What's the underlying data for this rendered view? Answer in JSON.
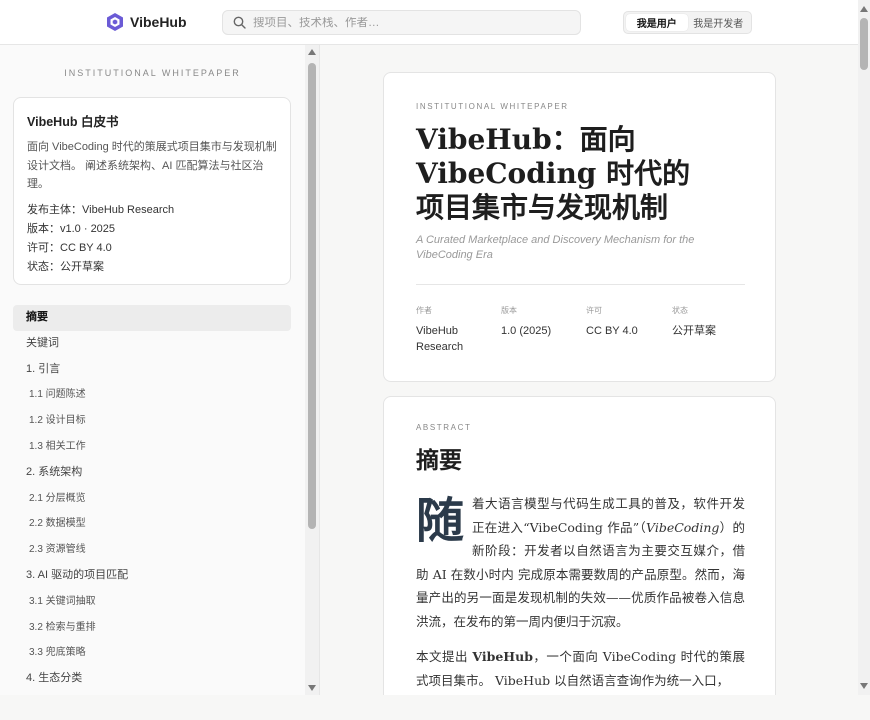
{
  "header": {
    "brand": "VibeHub",
    "search_placeholder": "搜项目、技术栈、作者…",
    "roles": [
      "我是用户",
      "我是开发者"
    ]
  },
  "sidebar": {
    "kicker": "INSTITUTIONAL WHITEPAPER",
    "card": {
      "title": "VibeHub 白皮书",
      "description": "面向 VibeCoding 时代的策展式项目集市与发现机制设计文档。 阐述系统架构、AI 匹配算法与社区治理。",
      "rows": [
        "发布主体：VibeHub Research",
        "版本：v1.0 · 2025",
        "许可：CC BY 4.0",
        "状态：公开草案"
      ]
    },
    "toc": [
      {
        "label": "摘要",
        "sub": false,
        "active": true
      },
      {
        "label": "关键词",
        "sub": false,
        "active": false
      },
      {
        "label": "1. 引言",
        "sub": false,
        "active": false
      },
      {
        "label": "1.1 问题陈述",
        "sub": true,
        "active": false
      },
      {
        "label": "1.2 设计目标",
        "sub": true,
        "active": false
      },
      {
        "label": "1.3 相关工作",
        "sub": true,
        "active": false
      },
      {
        "label": "2. 系统架构",
        "sub": false,
        "active": false
      },
      {
        "label": "2.1 分层概览",
        "sub": true,
        "active": false
      },
      {
        "label": "2.2 数据模型",
        "sub": true,
        "active": false
      },
      {
        "label": "2.3 资源管线",
        "sub": true,
        "active": false
      },
      {
        "label": "3. AI 驱动的项目匹配",
        "sub": false,
        "active": false
      },
      {
        "label": "3.1 关键词抽取",
        "sub": true,
        "active": false
      },
      {
        "label": "3.2 检索与重排",
        "sub": true,
        "active": false
      },
      {
        "label": "3.3 兜底策略",
        "sub": true,
        "active": false
      },
      {
        "label": "4. 生态分类",
        "sub": false,
        "active": false
      }
    ]
  },
  "hero": {
    "kicker": "INSTITUTIONAL WHITEPAPER",
    "title_lines": [
      "VibeHub：面向",
      "VibeCoding 时代的",
      "项目集市与发现机制"
    ],
    "subtitle": "A Curated Marketplace and Discovery Mechanism for the VibeCoding Era",
    "meta": [
      {
        "label": "作者",
        "value": "VibeHub Research"
      },
      {
        "label": "版本",
        "value": "1.0 (2025)"
      },
      {
        "label": "许可",
        "value": "CC BY 4.0"
      },
      {
        "label": "状态",
        "value": "公开草案"
      }
    ]
  },
  "abstract": {
    "kicker": "ABSTRACT",
    "title": "摘要",
    "dropcap": "随",
    "p1_before": "着大语言模型与代码生成工具的普及，软件开发正在进入“VibeCoding 作品”（",
    "p1_italic": "VibeCoding",
    "p1_after": "）的新阶段：开发者以自然语言为主要交互媒介，借助 AI 在数小时内 完成原本需要数周的产品原型。然而，海量产出的另一面是发现机制的失效——优质作品被卷入信息洪流，在发布的第一周内便归于沉寂。",
    "p2_before": "本文提出 ",
    "p2_bold": "VibeHub",
    "p2_after": "，一个面向 VibeCoding 时代的策展式项目集市。 VibeHub 以自然语言查询作为统一入口，"
  }
}
